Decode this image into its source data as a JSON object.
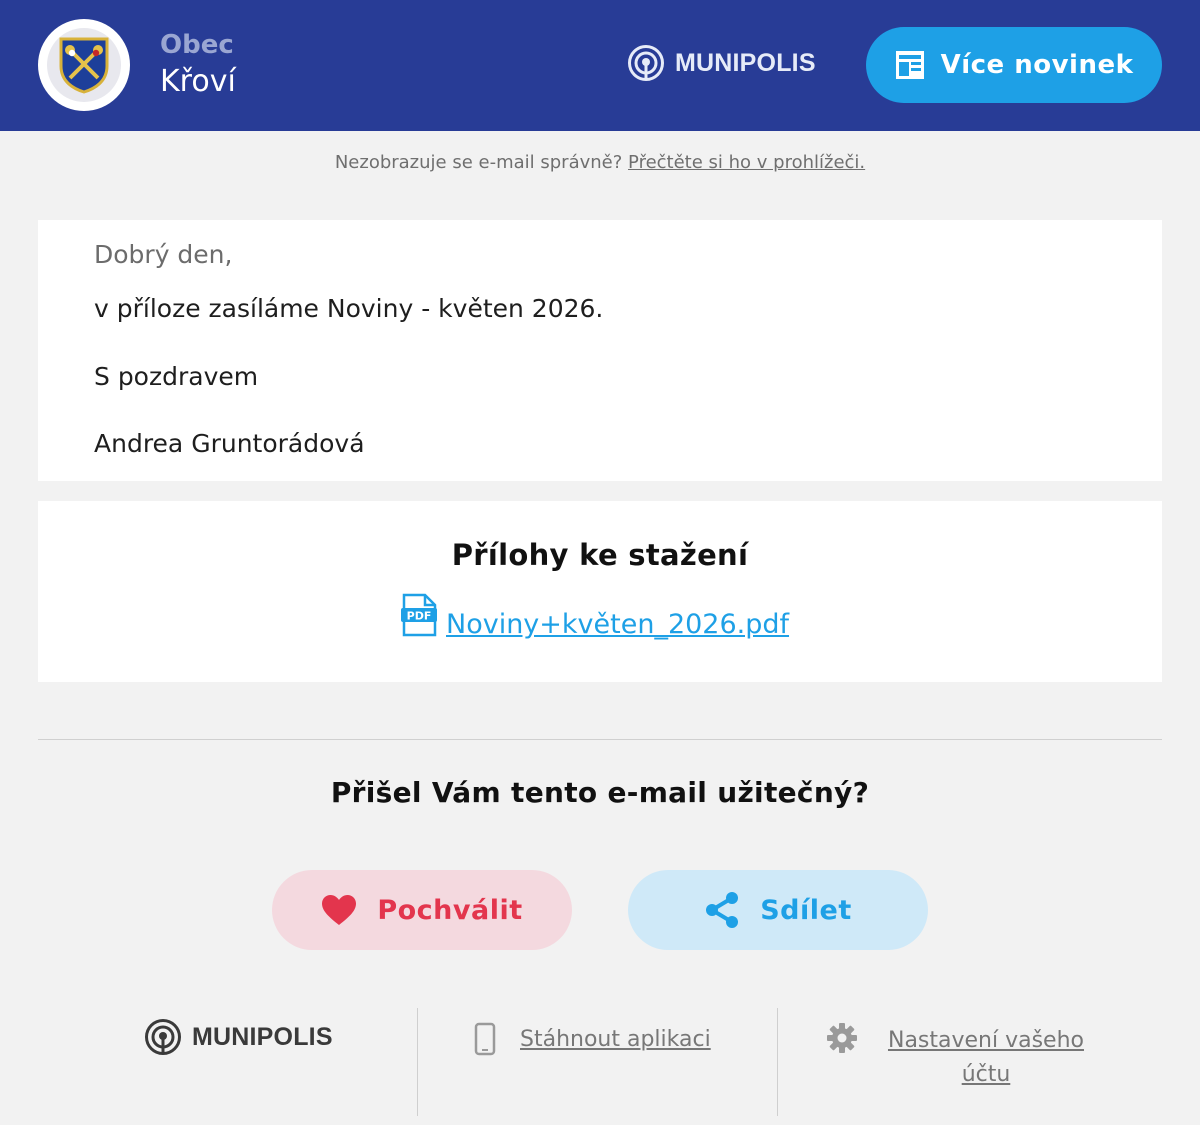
{
  "header": {
    "municipality_prefix": "Obec",
    "municipality_name": "Křoví",
    "brand": "MUNIPOLIS",
    "more_news_label": "Více novinek"
  },
  "notice": {
    "text": "Nezobrazuje se e-mail správně?",
    "link": "Přečtěte si ho v prohlížeči."
  },
  "message": {
    "greeting": "Dobrý den,",
    "line1": "v příloze zasíláme Noviny - květen 2026.",
    "line2": "S pozdravem",
    "signature": "Andrea Gruntorádová"
  },
  "attachments": {
    "title": "Přílohy ke stažení",
    "file_name": "Noviny+květen_2026.pdf",
    "file_badge": "PDF"
  },
  "feedback": {
    "question": "Přišel Vám tento e-mail užitečný?",
    "praise_label": "Pochválit",
    "share_label": "Sdílet"
  },
  "footer": {
    "brand": "MUNIPOLIS",
    "download_app": "Stáhnout aplikaci",
    "account_settings": "Nastavení vašeho účtu"
  },
  "colors": {
    "header_bg": "#283c96",
    "accent_blue": "#1ea0e6",
    "praise_red": "#e3354d",
    "praise_bg": "#f4d9df",
    "share_bg": "#cfe9f8",
    "page_bg": "#f2f2f2"
  },
  "icons": [
    "municipality-crest-icon",
    "munipolis-logo-icon",
    "newspaper-icon",
    "pdf-file-icon",
    "heart-icon",
    "share-icon",
    "smartphone-icon",
    "gear-icon"
  ]
}
